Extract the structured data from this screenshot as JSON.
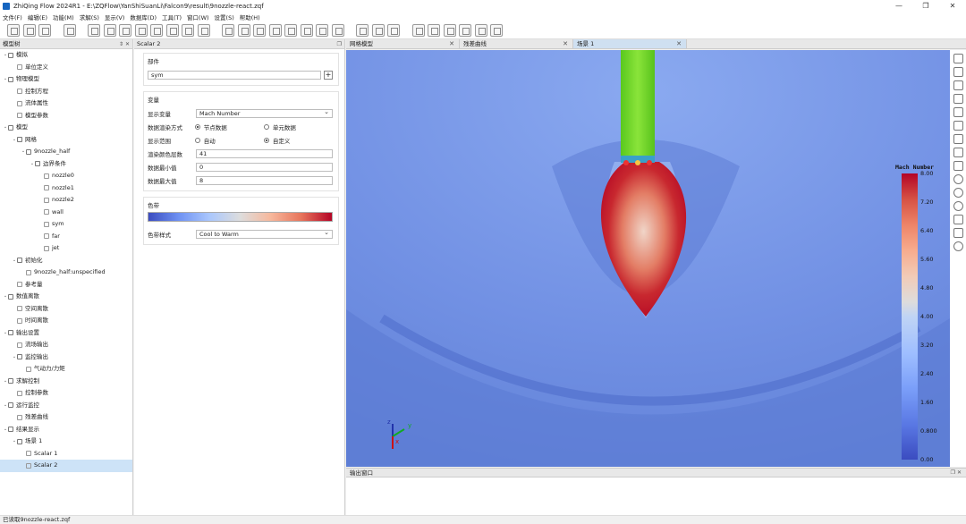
{
  "window": {
    "title": "ZhiQing Flow 2024R1 - E:\\ZQFlow\\YanShiSuanLi\\Falcon9\\result\\9nozzle-react.zqf"
  },
  "menu": [
    "文件(F)",
    "编辑(E)",
    "功能(M)",
    "求解(S)",
    "显示(V)",
    "数据库(D)",
    "工具(T)",
    "窗口(W)",
    "设置(S)",
    "帮助(H)"
  ],
  "model_tree": {
    "title": "模型树",
    "items": [
      {
        "label": "模拟",
        "depth": 0,
        "arrow": "v"
      },
      {
        "label": "单位定义",
        "depth": 1,
        "arrow": ""
      },
      {
        "label": "物理模型",
        "depth": 0,
        "arrow": "v"
      },
      {
        "label": "控制方程",
        "depth": 1,
        "arrow": ""
      },
      {
        "label": "流体属性",
        "depth": 1,
        "arrow": ""
      },
      {
        "label": "模型参数",
        "depth": 1,
        "arrow": ""
      },
      {
        "label": "模型",
        "depth": 0,
        "arrow": "v"
      },
      {
        "label": "网格",
        "depth": 1,
        "arrow": "v"
      },
      {
        "label": "9nozzle_half",
        "depth": 2,
        "arrow": "v"
      },
      {
        "label": "边界条件",
        "depth": 3,
        "arrow": "v"
      },
      {
        "label": "nozzle0",
        "depth": 4,
        "arrow": ""
      },
      {
        "label": "nozzle1",
        "depth": 4,
        "arrow": ""
      },
      {
        "label": "nozzle2",
        "depth": 4,
        "arrow": ""
      },
      {
        "label": "wall",
        "depth": 4,
        "arrow": ""
      },
      {
        "label": "sym",
        "depth": 4,
        "arrow": ""
      },
      {
        "label": "far",
        "depth": 4,
        "arrow": ""
      },
      {
        "label": "jet",
        "depth": 4,
        "arrow": ""
      },
      {
        "label": "初始化",
        "depth": 1,
        "arrow": "v"
      },
      {
        "label": "9nozzle_half:unspecified",
        "depth": 2,
        "arrow": ""
      },
      {
        "label": "参考量",
        "depth": 1,
        "arrow": ""
      },
      {
        "label": "数值离散",
        "depth": 0,
        "arrow": "v"
      },
      {
        "label": "空间离散",
        "depth": 1,
        "arrow": ""
      },
      {
        "label": "时间离散",
        "depth": 1,
        "arrow": ""
      },
      {
        "label": "输出设置",
        "depth": 0,
        "arrow": "v"
      },
      {
        "label": "流场输出",
        "depth": 1,
        "arrow": ""
      },
      {
        "label": "监控输出",
        "depth": 1,
        "arrow": "v"
      },
      {
        "label": "气动力/力矩",
        "depth": 2,
        "arrow": ""
      },
      {
        "label": "求解控制",
        "depth": 0,
        "arrow": "v"
      },
      {
        "label": "控制参数",
        "depth": 1,
        "arrow": ""
      },
      {
        "label": "运行监控",
        "depth": 0,
        "arrow": "v"
      },
      {
        "label": "残差曲线",
        "depth": 1,
        "arrow": ""
      },
      {
        "label": "结果显示",
        "depth": 0,
        "arrow": "v"
      },
      {
        "label": "场景 1",
        "depth": 1,
        "arrow": "v"
      },
      {
        "label": "Scalar 1",
        "depth": 2,
        "arrow": ""
      },
      {
        "label": "Scalar 2",
        "depth": 2,
        "arrow": "",
        "selected": true
      }
    ]
  },
  "properties": {
    "title": "Scalar 2",
    "part": {
      "title": "部件",
      "value": "sym"
    },
    "variable": {
      "title": "变量",
      "display_var_label": "显示变量",
      "display_var_value": "Mach Number",
      "render_mode_label": "数据渲染方式",
      "render_opt1": "节点数据",
      "render_opt2": "单元数据",
      "range_label": "显示范围",
      "range_opt1": "自动",
      "range_opt2": "自定义",
      "levels_label": "渲染颜色层数",
      "levels_value": "41",
      "min_label": "数据最小值",
      "min_value": "0",
      "max_label": "数据最大值",
      "max_value": "8"
    },
    "colormap": {
      "title": "色带",
      "style_label": "色带样式",
      "style_value": "Cool to Warm"
    }
  },
  "tabs": [
    {
      "label": "网格模型",
      "active": false
    },
    {
      "label": "残差曲线",
      "active": false
    },
    {
      "label": "场景 1",
      "active": true
    }
  ],
  "legend": {
    "title": "Mach Number",
    "ticks": [
      "8.00",
      "7.20",
      "6.40",
      "5.60",
      "4.80",
      "4.00",
      "3.20",
      "2.40",
      "1.60",
      "0.800",
      "0.00"
    ]
  },
  "axes": {
    "x": "x",
    "y": "y",
    "z": "z"
  },
  "output": {
    "title": "输出窗口"
  },
  "status": {
    "text": "已读取9nozzle-react.zqf"
  }
}
